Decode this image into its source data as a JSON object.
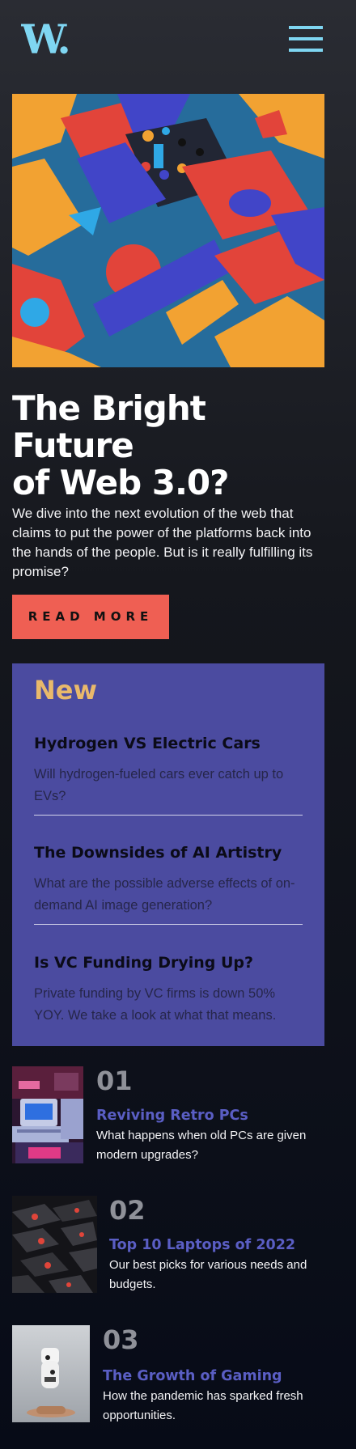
{
  "header": {
    "logo_text": "W.",
    "logo_color": "#7fd6f2"
  },
  "hero": {
    "image": "colorful-3d-geometric-blocks",
    "title_line1": "The Bright Future",
    "title_line2": "of Web 3.0?",
    "description": "We dive into the next evolution of the web that claims to put the power of the platforms back into the hands of the people. But is it really fulfilling its promise?",
    "button_label": "READ MORE"
  },
  "new_section": {
    "title": "New",
    "items": [
      {
        "title": "Hydrogen VS Electric Cars",
        "description": "Will hydrogen-fueled cars ever catch up to EVs?"
      },
      {
        "title": "The Downsides of AI Artistry",
        "description": "What are the possible adverse effects of on-demand AI image generation?"
      },
      {
        "title": "Is VC Funding Drying Up?",
        "description": "Private funding by VC firms is down 50% YOY. We take a look at what that means."
      }
    ]
  },
  "ranked": [
    {
      "number": "01",
      "title": "Reviving Retro PCs",
      "description": "What happens when old PCs are given modern upgrades?",
      "image": "retro-pc-image"
    },
    {
      "number": "02",
      "title": "Top 10 Laptops of 2022",
      "description": "Our best picks for various needs and budgets.",
      "image": "keyboard-image"
    },
    {
      "number": "03",
      "title": "The Growth of Gaming",
      "description": "How the pandemic has sparked fresh opportunities.",
      "image": "gamepad-image"
    }
  ],
  "colors": {
    "accent_cyan": "#7fd6f2",
    "accent_red": "#ef5f53",
    "panel_blue": "#4b4ba0",
    "heading_gold": "#e9b96b",
    "link_blue": "#5a5ec4"
  }
}
